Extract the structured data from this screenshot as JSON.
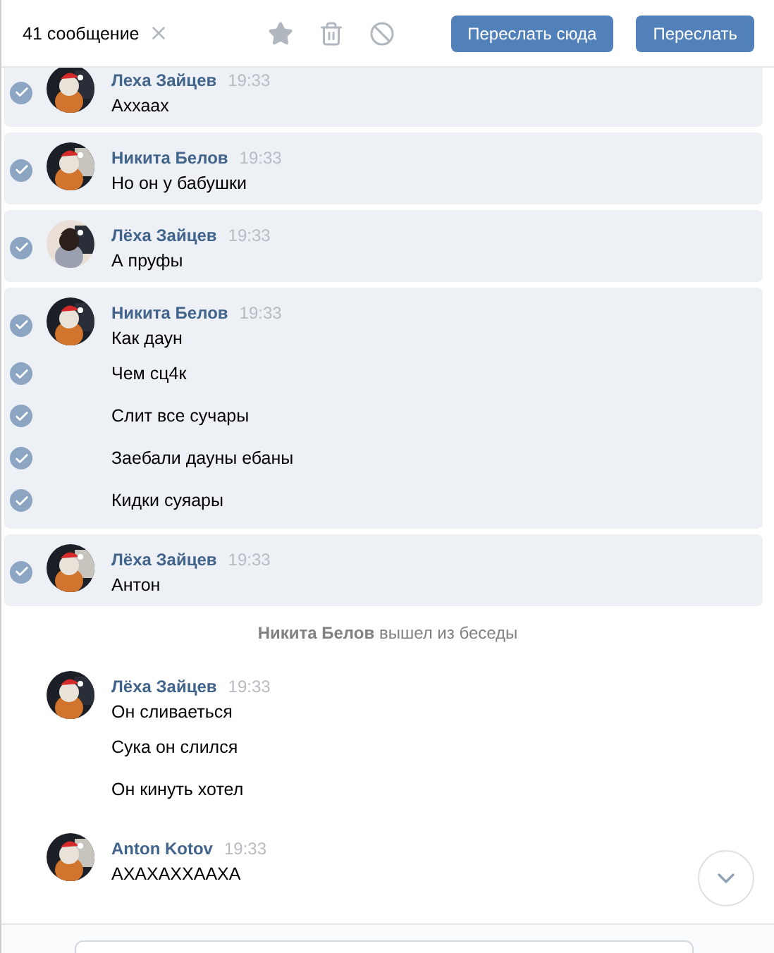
{
  "header": {
    "count": "41 сообщение",
    "buttons": [
      "Переслать сюда",
      "Переслать"
    ]
  },
  "feed": [
    {
      "kind": "group",
      "author": "Леха Зайцев",
      "time": "19:33",
      "lines": [
        {
          "text": "Аххаах",
          "selected": true
        }
      ]
    },
    {
      "kind": "group",
      "author": "Никита Белов",
      "time": "19:33",
      "lines": [
        {
          "text": "Но он у бабушки",
          "selected": true
        }
      ]
    },
    {
      "kind": "group",
      "author": "Лёха Зайцев",
      "time": "19:33",
      "lines": [
        {
          "text": "А пруфы",
          "selected": true
        }
      ]
    },
    {
      "kind": "group",
      "author": "Никита Белов",
      "time": "19:33",
      "lines": [
        {
          "text": "Как даун",
          "selected": true
        },
        {
          "text": "Чем сц4к",
          "selected": true
        },
        {
          "text": "Слит все сучары",
          "selected": true
        },
        {
          "text": "Заебали дауны ебаны",
          "selected": true
        },
        {
          "text": "Кидки суяары",
          "selected": true
        }
      ]
    },
    {
      "kind": "group",
      "author": "Лёха Зайцев",
      "time": "19:33",
      "lines": [
        {
          "text": "Антон",
          "selected": true
        }
      ]
    },
    {
      "kind": "service",
      "actor": "Никита Белов",
      "text": "вышел из беседы"
    },
    {
      "kind": "group",
      "author": "Лёха Зайцев",
      "time": "19:33",
      "lines": [
        {
          "text": "Он сливаеться",
          "selected": false
        },
        {
          "text": "Сука он слился",
          "selected": false
        },
        {
          "text": "Он кинуть хотел",
          "selected": false
        }
      ]
    },
    {
      "kind": "group",
      "author": "Anton Kotov",
      "time": "19:33",
      "lines": [
        {
          "text": "АХАХАХХААХА",
          "selected": false
        }
      ]
    }
  ]
}
